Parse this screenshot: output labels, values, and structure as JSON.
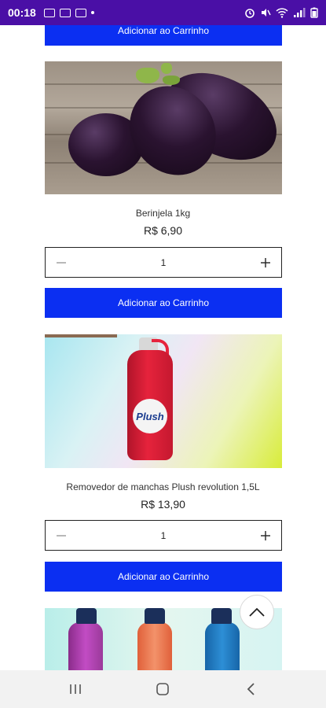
{
  "status_bar": {
    "time": "00:18",
    "left_icons": [
      "image-icon",
      "card-icon",
      "card-icon",
      "dot-icon"
    ],
    "right_icons": [
      "alarm-icon",
      "mute-icon",
      "wifi-icon",
      "signal-icon",
      "battery-icon"
    ]
  },
  "products": [
    {
      "add_label": "Adicionar ao Carrinho"
    },
    {
      "name": "Berinjela 1kg",
      "price": "R$ 6,90",
      "quantity": "1",
      "add_label": "Adicionar ao Carrinho",
      "image": "eggplant-image"
    },
    {
      "name": "Removedor de manchas Plush revolution 1,5L",
      "price": "R$ 13,90",
      "quantity": "1",
      "add_label": "Adicionar ao Carrinho",
      "image": "plush-bottle-image",
      "logo_text": "Plush"
    },
    {
      "image": "bottles-image"
    }
  ],
  "colors": {
    "status_bar_bg": "#4a0fa6",
    "add_button_bg": "#0b2ff2"
  },
  "nav_bar": {
    "buttons": [
      "recent-apps-icon",
      "home-icon",
      "back-icon"
    ]
  }
}
